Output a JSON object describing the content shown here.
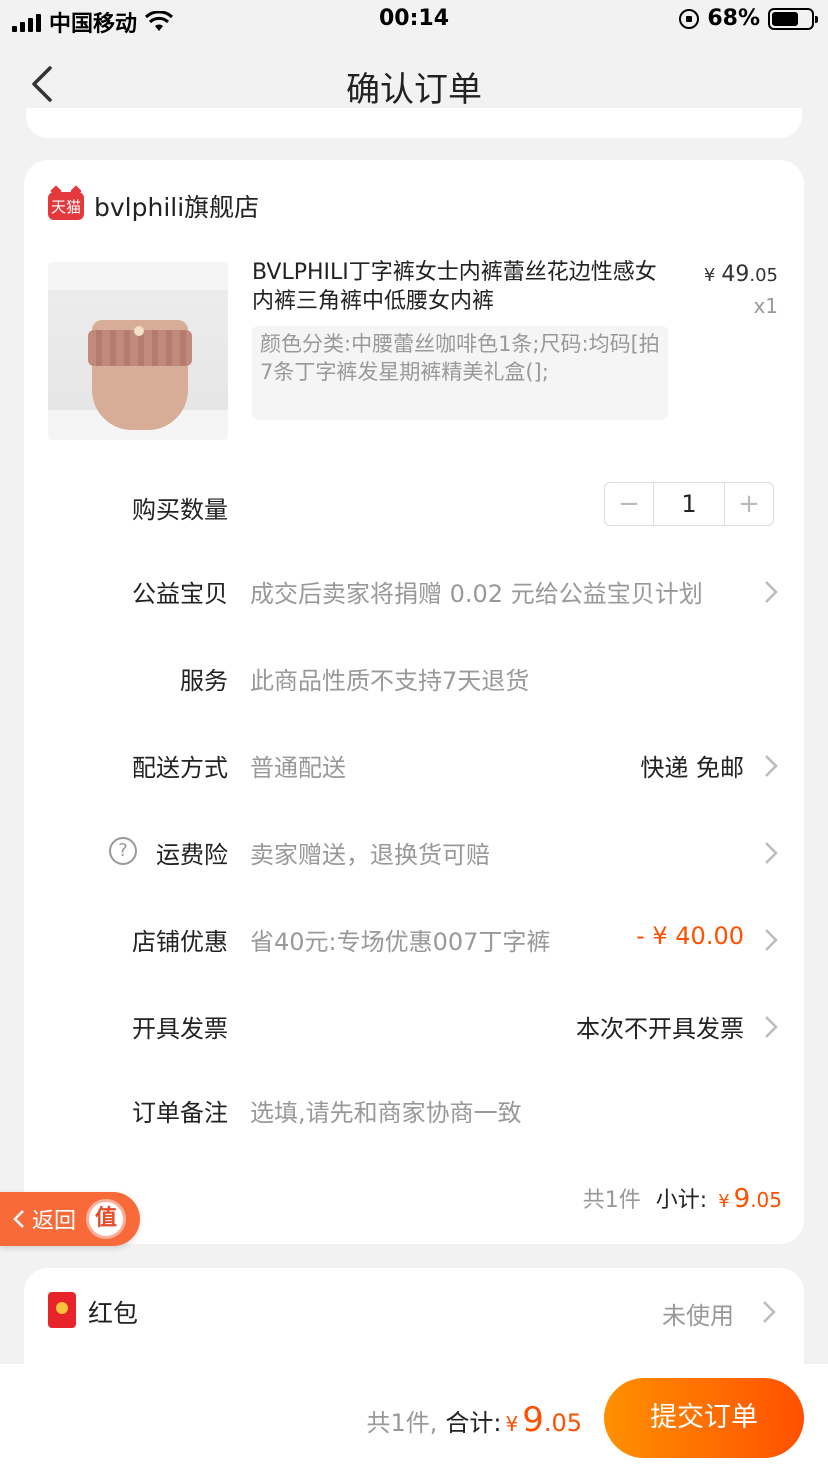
{
  "status_bar": {
    "carrier": "中国移动",
    "time": "00:14",
    "battery": "68%",
    "battery_level": 0.68
  },
  "nav": {
    "title": "确认订单"
  },
  "shop": {
    "badge": "天猫",
    "name": "bvlphili旗舰店"
  },
  "product": {
    "title": "BVLPHILI丁字裤女士内裤蕾丝花边性感女内裤三角裤中低腰女内裤",
    "price_symbol": "¥",
    "price_main": "49",
    "price_cents": ".05",
    "quantity_x": "x1",
    "sku": "颜色分类:中腰蕾丝咖啡色1条;尺码:均码[拍7条丁字裤发星期裤精美礼盒(];"
  },
  "rows": {
    "quantity": {
      "label": "购买数量",
      "value": "1",
      "minus": "−",
      "plus": "+"
    },
    "charity": {
      "label": "公益宝贝",
      "value": "成交后卖家将捐赠 0.02 元给公益宝贝计划"
    },
    "service": {
      "label": "服务",
      "value": "此商品性质不支持7天退货"
    },
    "delivery": {
      "label": "配送方式",
      "value": "普通配送",
      "right": "快递 免邮"
    },
    "insurance": {
      "label": "运费险",
      "value": "卖家赠送，退换货可赔",
      "help": "?"
    },
    "store_discount": {
      "label": "店铺优惠",
      "value": "省40元:专场优惠007丁字裤",
      "right": "- ¥ 40.00"
    },
    "invoice": {
      "label": "开具发票",
      "right": "本次不开具发票"
    },
    "note": {
      "label": "订单备注",
      "placeholder": "选填,请先和商家协商一致"
    }
  },
  "subtotal": {
    "count": "共1件",
    "label": "小计:",
    "symbol": "¥",
    "main": "9",
    "cents": ".05"
  },
  "float_back": {
    "label": "返回",
    "badge": "值"
  },
  "red_packet": {
    "label": "红包",
    "value": "未使用"
  },
  "bottom": {
    "count": "共1件,",
    "label": "合计:",
    "symbol": "¥",
    "main": "9",
    "cents": ".05",
    "submit": "提交订单"
  },
  "colors": {
    "accent": "#ff5000",
    "gradient_start": "#ff9000",
    "tmall_red": "#e4393c"
  },
  "icons": [
    "signal-icon",
    "wifi-icon",
    "rotation-lock-icon",
    "battery-icon",
    "back-chevron-icon",
    "tmall-icon",
    "chevron-right-icon",
    "help-icon",
    "red-packet-icon"
  ]
}
